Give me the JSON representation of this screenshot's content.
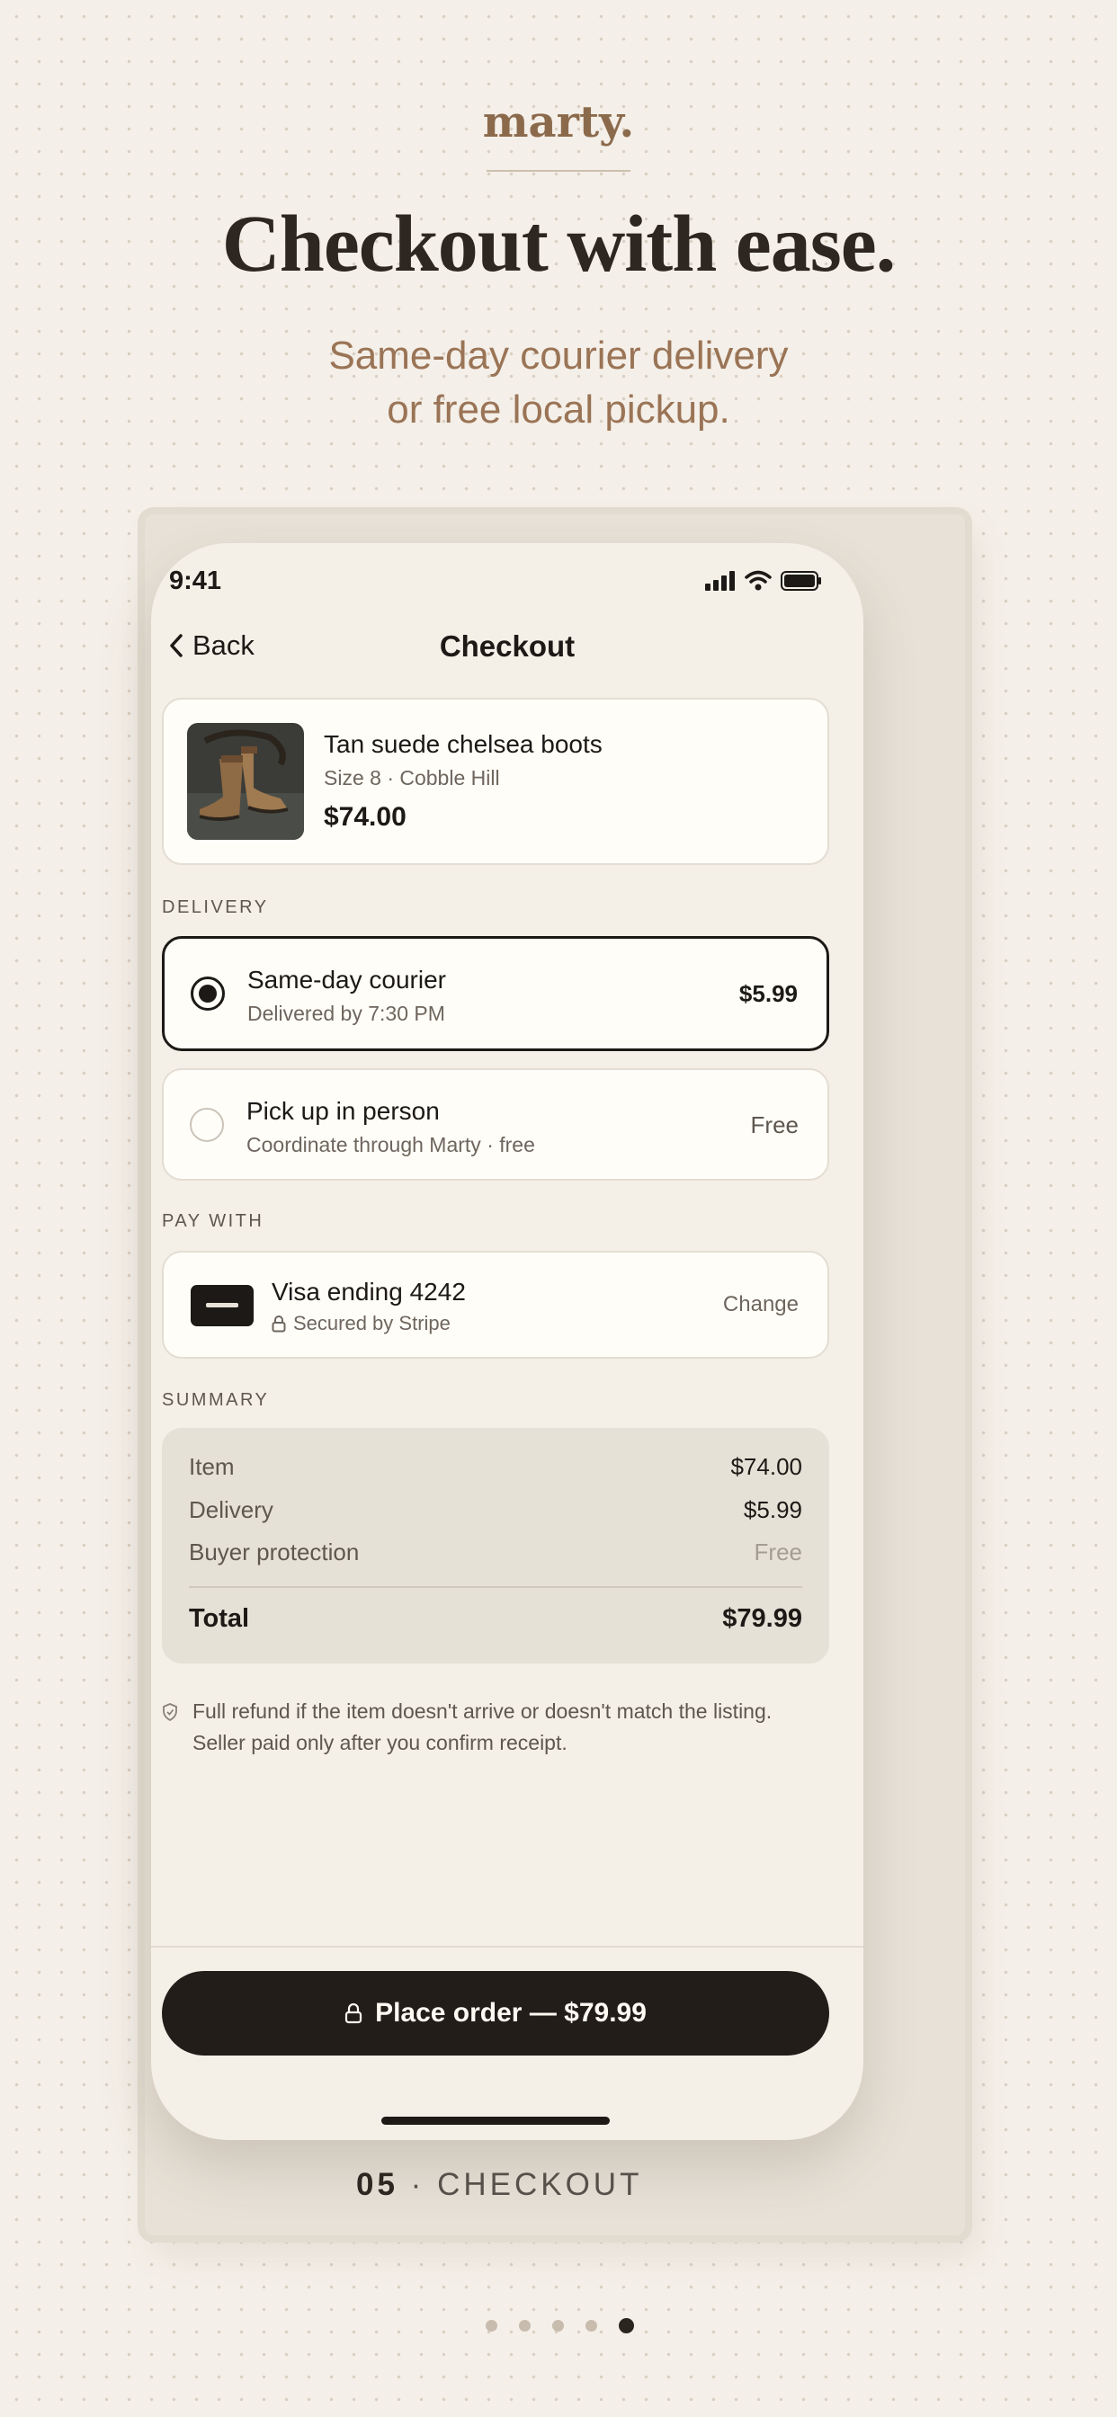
{
  "brand": "marty.",
  "headline": "Checkout with ease.",
  "subline": [
    "Same-day courier delivery",
    "or free local pickup."
  ],
  "status": {
    "time": "9:41"
  },
  "nav": {
    "back_label": "Back",
    "title": "Checkout"
  },
  "product": {
    "name": "Tan suede chelsea boots",
    "meta": "Size 8 · Cobble Hill",
    "price": "$74.00"
  },
  "delivery": {
    "label": "DELIVERY",
    "options": [
      {
        "title": "Same-day courier",
        "subtitle": "Delivered by 7:30 PM",
        "price": "$5.99",
        "selected": true
      },
      {
        "title": "Pick up in person",
        "subtitle": "Coordinate through Marty · free",
        "price": "Free",
        "selected": false
      }
    ]
  },
  "payment": {
    "label": "PAY WITH",
    "card": "Visa ending 4242",
    "secured": "Secured by Stripe",
    "change_label": "Change"
  },
  "summary": {
    "label": "SUMMARY",
    "rows": [
      {
        "label": "Item",
        "value": "$74.00"
      },
      {
        "label": "Delivery",
        "value": "$5.99"
      },
      {
        "label": "Buyer protection",
        "value": "Free"
      }
    ],
    "total_label": "Total",
    "total_value": "$79.99"
  },
  "note": [
    "Full refund if the item doesn't arrive or doesn't match the listing.",
    "Seller paid only after you confirm receipt."
  ],
  "cta": {
    "label": "Place order — $79.99"
  },
  "step": {
    "number": "05",
    "separator": "·",
    "label": "CHECKOUT"
  },
  "pager": {
    "count": 5,
    "active_index": 4
  },
  "colors": {
    "background": "#f4efe8",
    "brand": "#8b6a4c",
    "ink": "#1c1916",
    "cta": "#221d19",
    "surface": "#fffdf8"
  },
  "icons": [
    "chevron-left-icon",
    "signal-icon",
    "wifi-icon",
    "battery-icon",
    "radio-selected-icon",
    "radio-empty-icon",
    "card-icon",
    "lock-icon",
    "shield-icon"
  ]
}
